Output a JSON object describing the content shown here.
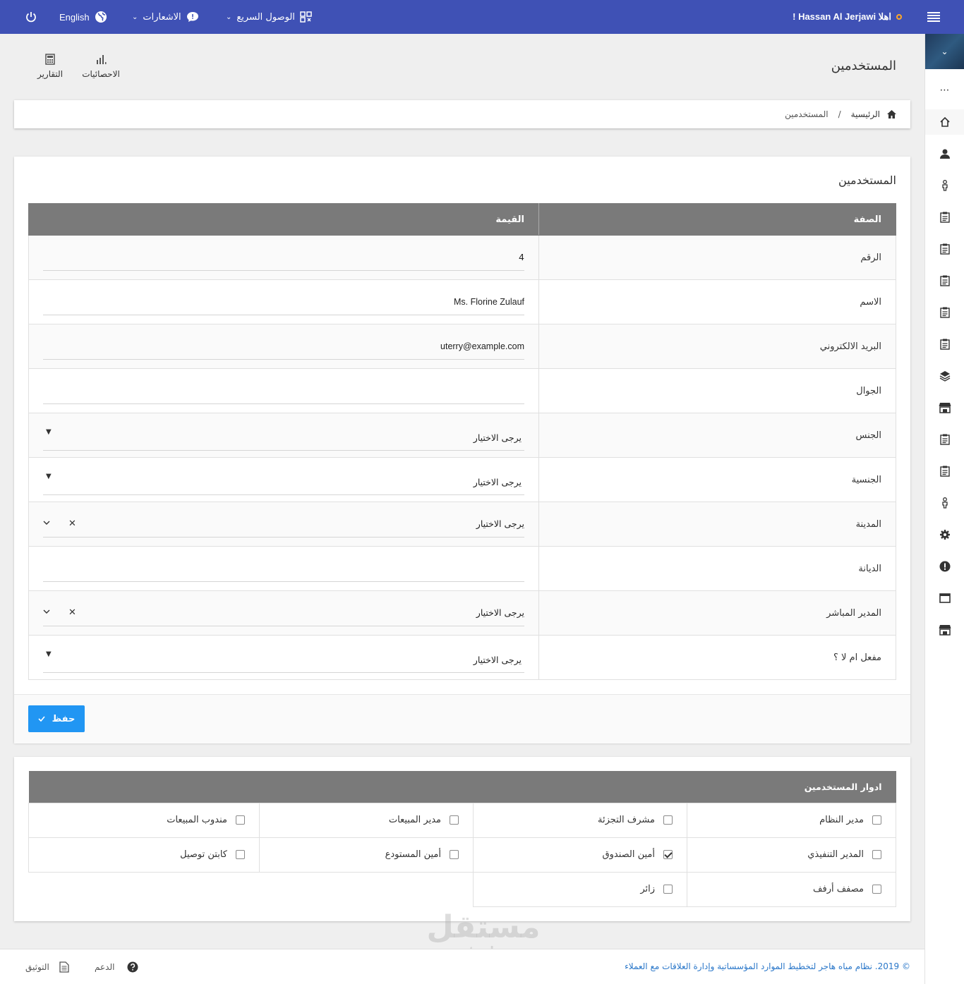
{
  "topbar": {
    "greeting": "! Hassan Al Jerjawi اهلا",
    "quick_access": "الوصول السريع",
    "notifications": "الاشعارات",
    "language": "English"
  },
  "header": {
    "page_title": "المستخدمين",
    "shortcuts": [
      {
        "label": "الاحصائيات",
        "icon": "bar-chart-icon"
      },
      {
        "label": "التقارير",
        "icon": "calculator-icon"
      }
    ]
  },
  "breadcrumb": {
    "home": "الرئيسية",
    "separator": "/",
    "current": "المستخدمين"
  },
  "form": {
    "title": "المستخدمين",
    "col_attribute": "الصفة",
    "col_value": "القيمة",
    "rows": [
      {
        "label": "الرقم",
        "value": "4"
      },
      {
        "label": "الاسم",
        "value": "Ms. Florine Zulauf"
      },
      {
        "label": "البريد الالكتروني",
        "value": "uterry@example.com"
      },
      {
        "label": "الجوال",
        "value": ""
      },
      {
        "label": "الجنس",
        "value": "يرجى الاختيار"
      },
      {
        "label": "الجنسية",
        "value": "يرجى الاختيار"
      },
      {
        "label": "المدينة",
        "value": "يرجى الاختيار"
      },
      {
        "label": "الديانة",
        "value": ""
      },
      {
        "label": "المدير المباشر",
        "value": "يرجى الاختيار"
      },
      {
        "label": "مفعل ام لا ؟",
        "value": "يرجى الاختيار"
      }
    ],
    "save_label": "حفظ"
  },
  "roles": {
    "title": "ادوار المستخدمين",
    "items": [
      {
        "label": "مدير النظام",
        "checked": false
      },
      {
        "label": "مشرف التجزئة",
        "checked": false
      },
      {
        "label": "مدير المبيعات",
        "checked": false
      },
      {
        "label": "مندوب المبيعات",
        "checked": false
      },
      {
        "label": "المدير التنفيذي",
        "checked": false
      },
      {
        "label": "أمين الصندوق",
        "checked": true
      },
      {
        "label": "أمين المستودع",
        "checked": false
      },
      {
        "label": "كابتن توصيل",
        "checked": false
      },
      {
        "label": "مصفف أرفف",
        "checked": false
      },
      {
        "label": "زائر",
        "checked": false
      }
    ]
  },
  "footer": {
    "copyright": "© 2019. نظام مياه هاجر لتخطيط الموارد المؤسساتية وإدارة العلاقات مع العملاء",
    "support": "الدعم",
    "docs": "التوثيق"
  },
  "watermark": {
    "ar": "مستقل",
    "en": "mostaql.com"
  },
  "colors": {
    "primary": "#3f51b5",
    "button": "#2196f3",
    "table_header": "#7a7a7a",
    "link": "#2a77c9"
  }
}
